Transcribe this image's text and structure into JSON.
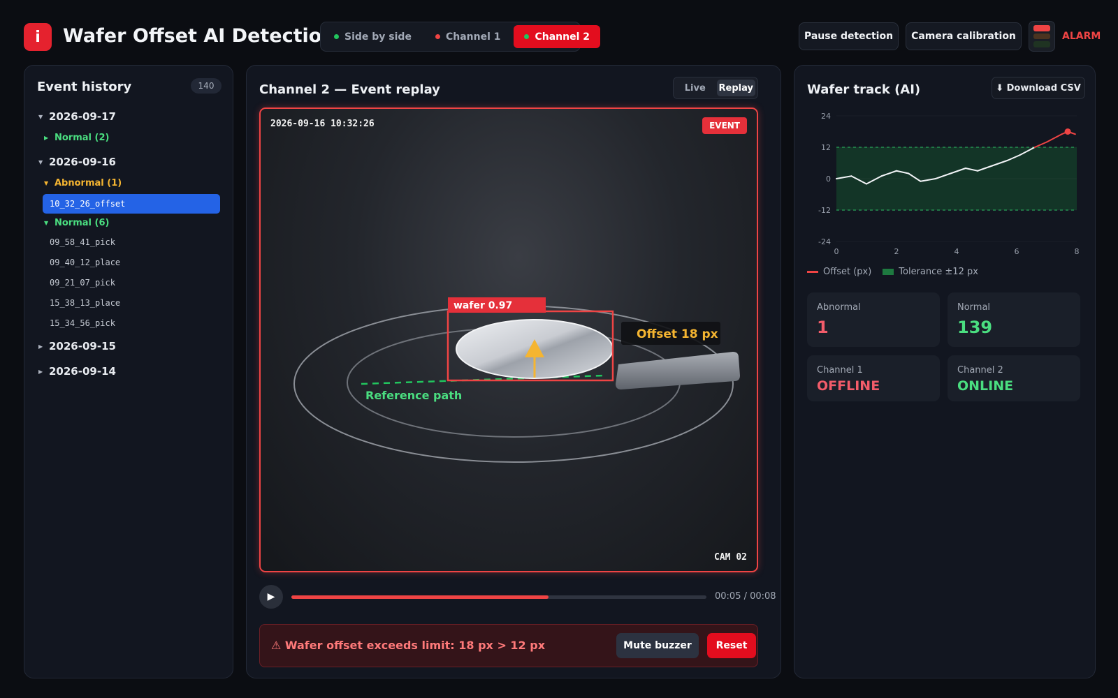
{
  "header": {
    "title": "Wafer Offset AI Detection",
    "logo_glyph": "i",
    "view_tabs": [
      {
        "label": "Side by side",
        "dot_color": "#22c55e",
        "active": false
      },
      {
        "label": "Channel 1",
        "dot_color": "#ef4444",
        "active": false
      },
      {
        "label": "Channel 2",
        "dot_color": "#22c55e",
        "active": true
      }
    ],
    "pause_label": "Pause detection",
    "calibration_label": "Camera calibration",
    "alarm_label": "ALARM"
  },
  "sidebar": {
    "title": "Event history",
    "count": "140",
    "dates": [
      {
        "label": "2026-09-17",
        "expanded": true
      },
      {
        "label": "2026-09-16",
        "expanded": true
      },
      {
        "label": "2026-09-15",
        "expanded": false
      },
      {
        "label": "2026-09-14",
        "expanded": false
      }
    ],
    "groups": [
      {
        "label": "Normal (2)",
        "color": "#4ade80"
      },
      {
        "label": "Abnormal (1)",
        "color": "#f5b531"
      },
      {
        "label": "Normal (6)",
        "color": "#4ade80"
      }
    ],
    "selected_item": "10_32_26_offset",
    "items": [
      "09_58_41_pick",
      "09_40_12_place",
      "09_21_07_pick",
      "15_38_13_place",
      "15_34_56_pick"
    ]
  },
  "center": {
    "title": "Channel 2 — Event replay",
    "mode_live": "Live",
    "mode_replay": "Replay",
    "timestamp": "2026-09-16 10:32:26",
    "event_badge": "EVENT",
    "camera": "CAM 02",
    "detection_label": "wafer 0.97",
    "offset_label": "Offset 18 px",
    "reference_label": "Reference path",
    "progress": 0.62,
    "time": "00:05 / 00:08",
    "alert_text": "Wafer offset exceeds limit: 18 px > 12 px",
    "mute_label": "Mute buzzer",
    "reset_label": "Reset"
  },
  "right": {
    "title": "Wafer track (AI)",
    "download_label": "⬇ Download CSV",
    "legend_offset": "Offset (px)",
    "legend_tolerance": "Tolerance ±12 px",
    "stats": [
      {
        "label": "Abnormal",
        "value": "1",
        "color": "#f25c6a"
      },
      {
        "label": "Normal",
        "value": "139",
        "color": "#4ade80"
      },
      {
        "label": "Channel 1",
        "value": "OFFLINE",
        "color": "#f25c6a"
      },
      {
        "label": "Channel 2",
        "value": "ONLINE",
        "color": "#4ade80"
      }
    ]
  },
  "chart_data": {
    "type": "line",
    "title": "",
    "xlabel": "",
    "ylabel": "",
    "xlim": [
      0,
      8
    ],
    "ylim": [
      -24,
      24
    ],
    "xticks": [
      0,
      2,
      4,
      6,
      8
    ],
    "yticks": [
      24,
      12,
      0,
      -12,
      -24
    ],
    "tolerance_band": [
      -12,
      12
    ],
    "series": [
      {
        "name": "Offset (px)",
        "normal_color": "#f2f4f7",
        "alarm_color": "#ef4444",
        "x": [
          0,
          0.5,
          1.0,
          1.5,
          2.0,
          2.4,
          2.8,
          3.3,
          3.8,
          4.3,
          4.7,
          5.2,
          5.7,
          6.1,
          6.6,
          7.0,
          7.5,
          7.7,
          7.95
        ],
        "y": [
          0,
          1,
          -2,
          1,
          3,
          2,
          -1,
          0,
          2,
          4,
          3,
          5,
          7,
          9,
          12,
          14,
          17,
          18,
          17
        ]
      }
    ],
    "grid": true,
    "legend_position": "bottom"
  }
}
